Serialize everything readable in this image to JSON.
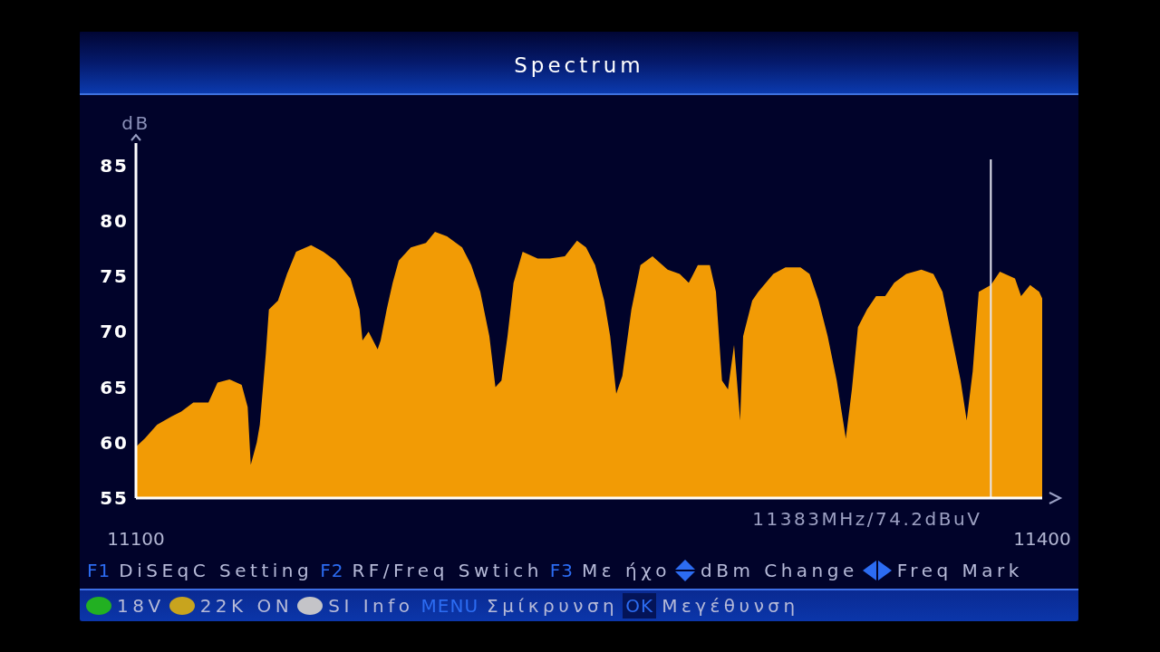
{
  "window": {
    "title": "Spectrum"
  },
  "spectrum": {
    "chart_data": {
      "type": "area",
      "ylabel": "dB",
      "xlim": [
        11100,
        11400
      ],
      "ylim": [
        55,
        87
      ],
      "xticks": [
        11100,
        11400
      ],
      "yticks": [
        55,
        60,
        65,
        70,
        75,
        80,
        85
      ],
      "x": [
        11100,
        11103,
        11107,
        11112,
        11115,
        11119,
        11124,
        11127,
        11131,
        11135,
        11137,
        11138,
        11140,
        11141,
        11143,
        11144,
        11147,
        11150,
        11153,
        11158,
        11162,
        11166,
        11171,
        11174,
        11175,
        11177,
        11180,
        11181,
        11183,
        11185,
        11187,
        11191,
        11196,
        11199,
        11203,
        11208,
        11211,
        11214,
        11217,
        11219,
        11221,
        11223,
        11225,
        11228,
        11233,
        11237,
        11242,
        11246,
        11249,
        11252,
        11255,
        11257,
        11259,
        11261,
        11264,
        11267,
        11271,
        11276,
        11280,
        11283,
        11286,
        11290,
        11292,
        11294,
        11296,
        11298,
        11300,
        11301,
        11304,
        11306,
        11311,
        11315,
        11320,
        11323,
        11326,
        11329,
        11332,
        11335,
        11337,
        11339,
        11342,
        11345,
        11348,
        11351,
        11355,
        11360,
        11364,
        11367,
        11370,
        11373,
        11375,
        11377,
        11379,
        11383,
        11386,
        11391,
        11393,
        11396,
        11399,
        11400
      ],
      "values": [
        59.6,
        60.4,
        61.6,
        62.4,
        62.8,
        63.6,
        63.6,
        65.4,
        65.7,
        65.2,
        63.2,
        58.0,
        60.0,
        61.6,
        68.0,
        72.0,
        72.8,
        75.2,
        77.2,
        77.8,
        77.2,
        76.4,
        74.8,
        72.0,
        69.2,
        70.0,
        68.4,
        69.2,
        72.0,
        74.4,
        76.4,
        77.6,
        78.0,
        79.0,
        78.6,
        77.6,
        76.0,
        73.6,
        69.6,
        65.0,
        65.6,
        69.6,
        74.4,
        77.2,
        76.6,
        76.6,
        76.8,
        78.2,
        77.6,
        76.0,
        72.8,
        69.6,
        64.4,
        66.0,
        72.0,
        76.0,
        76.8,
        75.6,
        75.2,
        74.4,
        76.0,
        76.0,
        73.6,
        65.6,
        64.8,
        68.8,
        62.0,
        69.6,
        72.8,
        73.6,
        75.2,
        75.8,
        75.8,
        75.2,
        72.8,
        69.6,
        65.6,
        60.4,
        64.8,
        70.4,
        72.0,
        73.2,
        73.2,
        74.4,
        75.2,
        75.6,
        75.2,
        73.6,
        69.6,
        65.6,
        62.0,
        66.4,
        73.6,
        74.2,
        75.4,
        74.8,
        73.2,
        74.2,
        73.6,
        73.0
      ],
      "ref_lines": [
        {
          "axis": "x",
          "value": 11383,
          "label": "11383MHz/74.2dBuV"
        }
      ]
    }
  },
  "help_bar": {
    "items": [
      {
        "kind": "key",
        "key": "F1",
        "label": "DiSEqC Setting"
      },
      {
        "kind": "key",
        "key": "F2",
        "label": "RF/Freq Swtich"
      },
      {
        "kind": "key",
        "key": "F3",
        "label": "Με ήχο"
      },
      {
        "kind": "updown",
        "label": "dBm Change"
      },
      {
        "kind": "leftright",
        "label": "Freq Mark"
      }
    ]
  },
  "status_bar": {
    "items": [
      {
        "kind": "dot",
        "color": "#22b022",
        "label": "18V"
      },
      {
        "kind": "dot",
        "color": "#c8a41e",
        "label": "22K ON"
      },
      {
        "kind": "dot",
        "color": "#c4c4c8",
        "label": "SI Info"
      },
      {
        "kind": "key",
        "key": "MENU",
        "highlighted": false,
        "label": "Σμίκρυνση"
      },
      {
        "kind": "key",
        "key": "OK",
        "highlighted": true,
        "label": "Μεγέθυνση"
      }
    ]
  }
}
